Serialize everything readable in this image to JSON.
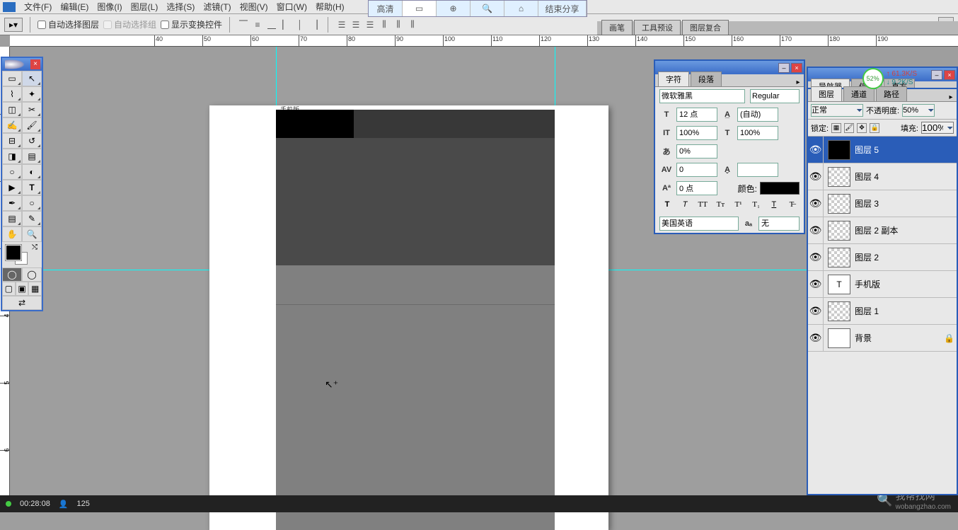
{
  "menu": {
    "file": "文件(F)",
    "edit": "编辑(E)",
    "image": "图像(I)",
    "layer": "图层(L)",
    "select": "选择(S)",
    "filter": "滤镜(T)",
    "view": "视图(V)",
    "window": "窗口(W)",
    "help": "帮助(H)"
  },
  "share": {
    "hd": "高清",
    "end": "结束分享"
  },
  "options": {
    "autoSelect": "自动选择图层",
    "autoSelectGroup": "自动选择组",
    "showTransform": "显示变换控件"
  },
  "dockTabs": {
    "brushes": "画笔",
    "toolPresets": "工具预设",
    "layerComps": "图层复合"
  },
  "charPanel": {
    "tabChar": "字符",
    "tabPara": "段落",
    "font": "微软雅黑",
    "style": "Regular",
    "size": "12 点",
    "leading": "(自动)",
    "vscale": "100%",
    "hscale": "100%",
    "tracking": "0%",
    "kerning": "0",
    "baseline": "0 点",
    "colorLabel": "颜色:",
    "lang": "美国英语",
    "aa": "无"
  },
  "navPanel": {
    "tab1": "导航器",
    "tab2": "信息",
    "tab3": "直方"
  },
  "layersPanel": {
    "tab1": "图层",
    "tab2": "通道",
    "tab3": "路径",
    "blend": "正常",
    "opacityLbl": "不透明度:",
    "opacity": "50%",
    "lockLbl": "锁定:",
    "fillLbl": "填充:",
    "fill": "100%",
    "layers": [
      {
        "name": "图层 5",
        "thumb": "black",
        "selected": true
      },
      {
        "name": "图层 4",
        "thumb": "checker"
      },
      {
        "name": "图层 3",
        "thumb": "checker"
      },
      {
        "name": "图层 2 副本",
        "thumb": "checker"
      },
      {
        "name": "图层 2",
        "thumb": "checker"
      },
      {
        "name": "手机版",
        "thumb": "text"
      },
      {
        "name": "图层 1",
        "thumb": "checker"
      },
      {
        "name": "背景",
        "thumb": "white",
        "locked": true
      }
    ]
  },
  "speed": {
    "pct": "52%",
    "up": "↑ 61.3K/S",
    "dn": "↓ 9.2K/S"
  },
  "doc": {
    "label": "手机版"
  },
  "status": {
    "time": "00:28:08",
    "count": "125"
  },
  "watermark": {
    "text": "我帮找网",
    "url": "wobangzhao.com"
  },
  "ruler": {
    "start": 40,
    "end": 190,
    "step": 10
  }
}
